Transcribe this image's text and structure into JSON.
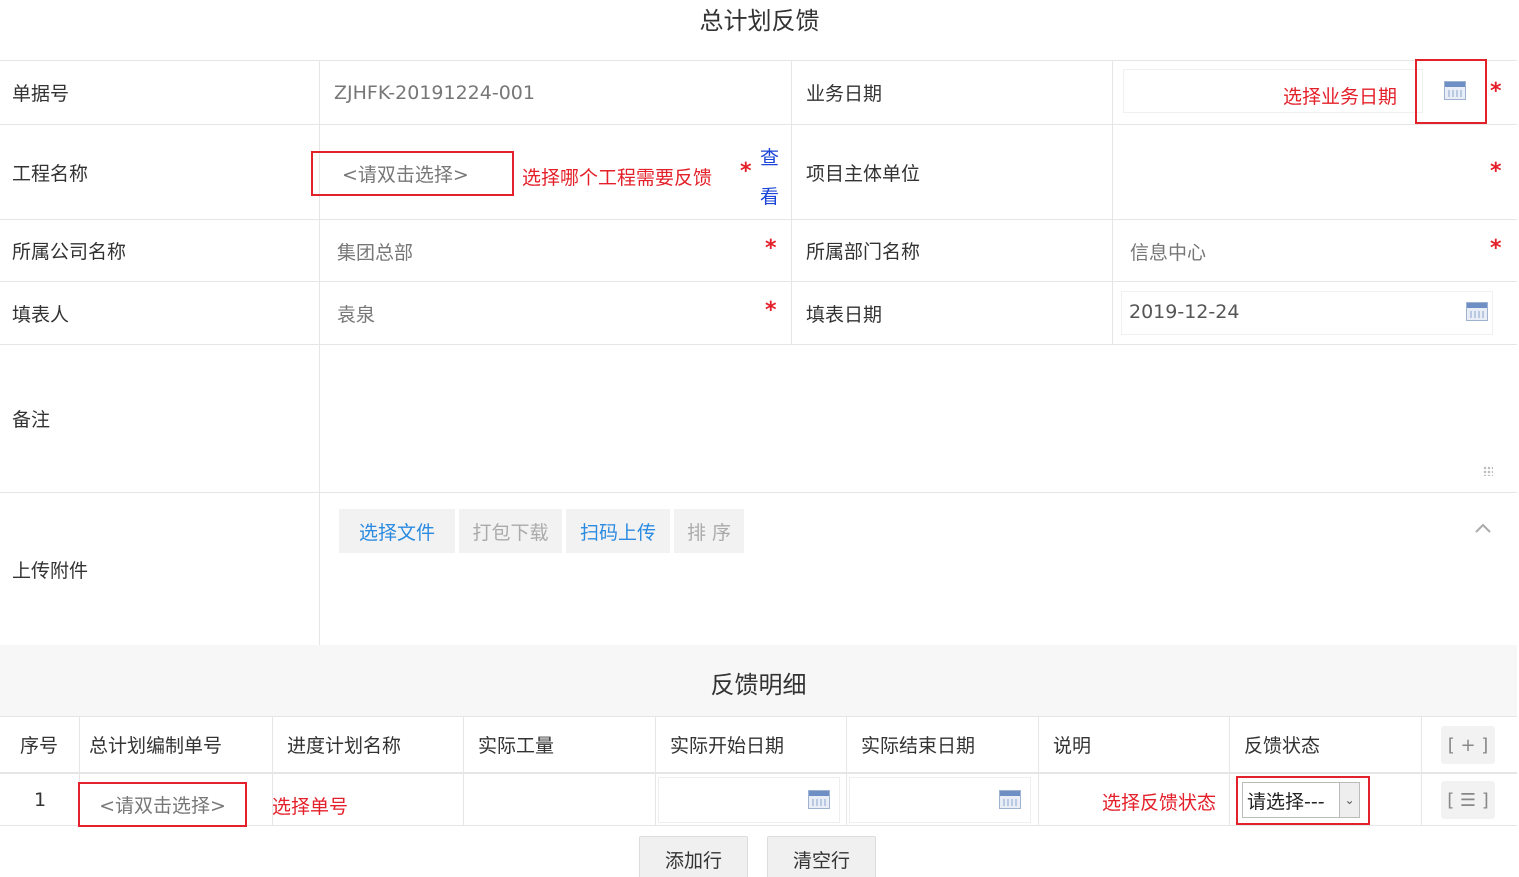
{
  "page": {
    "title": "总计划反馈"
  },
  "form": {
    "doc_no_label": "单据号",
    "doc_no_value": "ZJHFK-20191224-001",
    "biz_date_label": "业务日期",
    "biz_date_annotation": "选择业务日期",
    "project_label": "工程名称",
    "project_placeholder": "<请双击选择>",
    "project_annotation": "选择哪个工程需要反馈",
    "view_link": "查看",
    "view_link_char1": "查",
    "view_link_char2": "看",
    "owner_unit_label": "项目主体单位",
    "company_label": "所属公司名称",
    "company_value": "集团总部",
    "dept_label": "所属部门名称",
    "dept_value": "信息中心",
    "filler_label": "填表人",
    "filler_value": "袁泉",
    "fill_date_label": "填表日期",
    "fill_date_value": "2019-12-24",
    "remark_label": "备注",
    "attach_label": "上传附件",
    "required_mark": "*"
  },
  "attachments": {
    "choose_file": "选择文件",
    "pack_download": "打包下载",
    "scan_upload": "扫码上传",
    "sort": "排 序",
    "collapse_icon": "chevron-up-icon"
  },
  "detail": {
    "title": "反馈明细",
    "columns": [
      "序号",
      "总计划编制单号",
      "进度计划名称",
      "实际工量",
      "实际开始日期",
      "实际结束日期",
      "说明",
      "反馈状态"
    ],
    "add_col_button": "[ + ]",
    "row": {
      "index": "1",
      "plan_no_placeholder": "<请双击选择>",
      "plan_no_annotation": "选择单号",
      "status_annotation": "选择反馈状态",
      "status_selected": "请选择---",
      "row_menu_button": "[ ☰ ]"
    },
    "add_row": "添加行",
    "clear_rows": "清空行"
  },
  "colors": {
    "annotation_red": "#e4202a",
    "link_blue": "#2b8be0"
  }
}
